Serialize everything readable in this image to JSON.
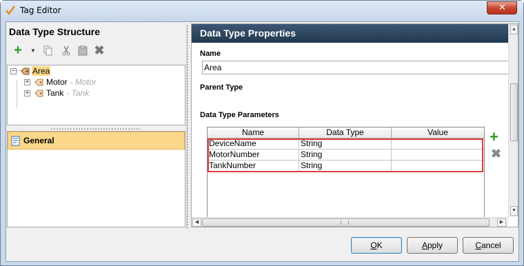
{
  "window": {
    "title": "Tag Editor",
    "close_label": "✕"
  },
  "left": {
    "header": "Data Type Structure",
    "toolbar": {
      "add_icon": "plus-icon",
      "dropdown_icon": "chevron-down-icon",
      "copy_icon": "copy-icon",
      "cut_icon": "scissors-icon",
      "paste_icon": "clipboard-icon",
      "delete_icon": "x-icon"
    },
    "tree": [
      {
        "label": "Area",
        "sub": "",
        "selected": true
      },
      {
        "label": "Motor",
        "sub": "- Motor",
        "selected": false
      },
      {
        "label": "Tank",
        "sub": "- Tank",
        "selected": false
      }
    ],
    "categories": [
      {
        "label": "General",
        "selected": true
      }
    ]
  },
  "right": {
    "header": "Data Type Properties",
    "name_label": "Name",
    "name_value": "Area",
    "parent_type_label": "Parent Type",
    "parameters_label": "Data Type Parameters",
    "table": {
      "columns": [
        "Name",
        "Data Type",
        "Value"
      ],
      "rows": [
        [
          "DeviceName",
          "String",
          ""
        ],
        [
          "MotorNumber",
          "String",
          ""
        ],
        [
          "TankNumber",
          "String",
          ""
        ]
      ]
    }
  },
  "buttons": {
    "ok": {
      "label": "OK",
      "mnemonic": "O",
      "rest": "K"
    },
    "apply": {
      "label": "Apply",
      "mnemonic": "A",
      "rest": "pply"
    },
    "cancel": {
      "label": "Cancel",
      "mnemonic": "C",
      "rest": "ancel"
    }
  },
  "colors": {
    "header_bg": "#2c455f",
    "selection": "#fad78a",
    "highlight": "#e03c3c",
    "add_green": "#2e9a22"
  }
}
